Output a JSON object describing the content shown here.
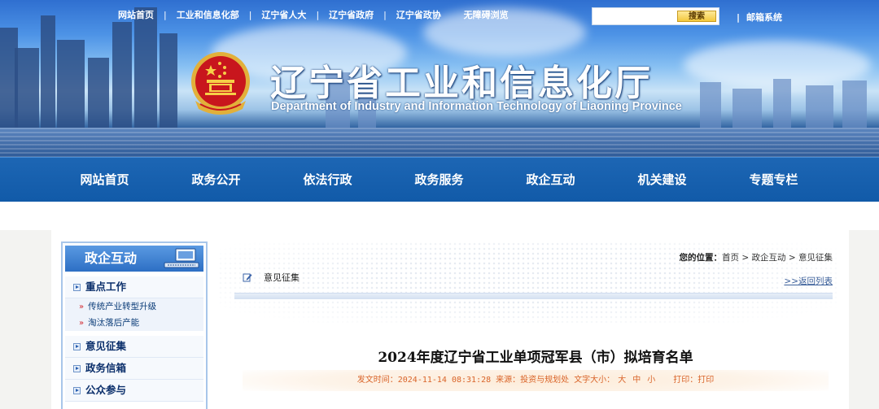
{
  "top_links": [
    "网站首页",
    "工业和信息化部",
    "辽宁省人大",
    "辽宁省政府",
    "辽宁省政协",
    "无障碍浏览"
  ],
  "search": {
    "placeholder": "",
    "button_label": "搜索"
  },
  "mail_system": "邮箱系统",
  "site": {
    "title_cn": "辽宁省工业和信息化厅",
    "title_en": "Department of Industry and Information Technology of Liaoning Province"
  },
  "main_nav": [
    "网站首页",
    "政务公开",
    "依法行政",
    "政务服务",
    "政企互动",
    "机关建设",
    "专题专栏"
  ],
  "sidebar": {
    "title": "政企互动",
    "items": [
      {
        "label": "重点工作",
        "subs": [
          "传统产业转型升级",
          "淘汰落后产能"
        ]
      },
      {
        "label": "意见征集",
        "subs": []
      },
      {
        "label": "政务信箱",
        "subs": []
      },
      {
        "label": "公众参与",
        "subs": []
      }
    ]
  },
  "location": {
    "label": "您的位置：",
    "crumbs": [
      "首页",
      "政企互动",
      "意见征集"
    ],
    "sep": " > "
  },
  "category": "意见征集",
  "back_link": ">>返回列表",
  "article": {
    "title": "2024年度辽宁省工业单项冠军县（市）拟培育名单",
    "date_label": "发文时间：",
    "date": "2024-11-14 08:31:28",
    "source_label": "来源：",
    "source": "投资与规划处",
    "font_size_label": "文字大小：",
    "sizes": [
      "大",
      "中",
      "小"
    ],
    "print_label": "打印：",
    "print_link": "打印"
  },
  "colors": {
    "nav_blue": "#1d66b4",
    "sidebar_head": "#2d6fc4",
    "meta_orange": "#d9642a"
  }
}
